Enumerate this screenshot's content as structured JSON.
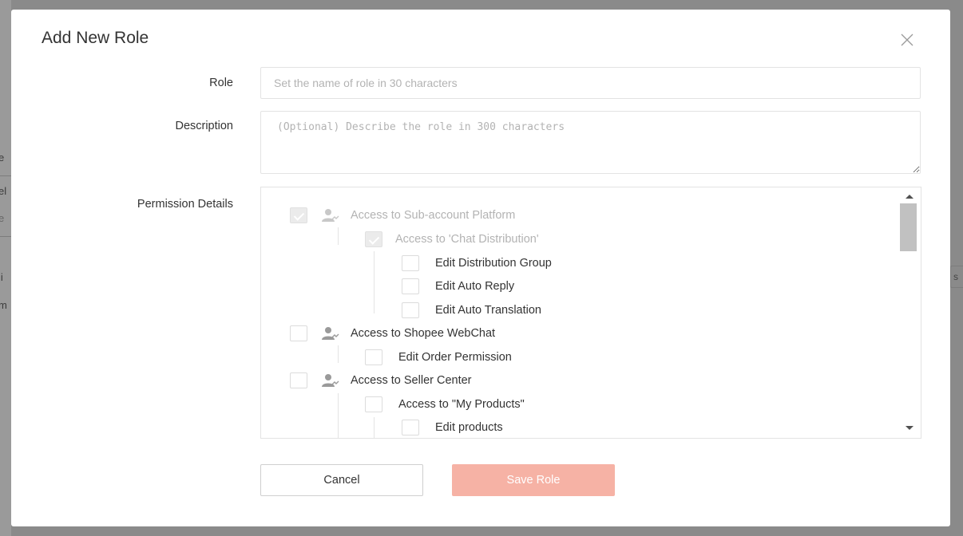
{
  "modal": {
    "title": "Add New Role"
  },
  "form": {
    "role_label": "Role",
    "role_placeholder": "Set the name of role in 30 characters",
    "role_value": "",
    "description_label": "Description",
    "description_placeholder": "(Optional) Describe the role in 300 characters",
    "description_value": "",
    "permission_label": "Permission Details"
  },
  "permissions": {
    "sub_account_platform": "Access to Sub-account Platform",
    "chat_distribution": "Access to 'Chat Distribution'",
    "edit_distribution_group": "Edit Distribution Group",
    "edit_auto_reply": "Edit Auto Reply",
    "edit_auto_translation": "Edit Auto Translation",
    "shopee_webchat": "Access to Shopee WebChat",
    "edit_order_permission": "Edit Order Permission",
    "seller_center": "Access to Seller Center",
    "my_products": "Access to \"My Products\"",
    "edit_products": "Edit products"
  },
  "buttons": {
    "cancel": "Cancel",
    "save": "Save Role"
  },
  "background": {
    "frag_1": "e",
    "frag_2": "el",
    "frag_3": "e",
    "frag_4": "li",
    "frag_5": "m",
    "right_frag": "s"
  },
  "colors": {
    "save_button": "#f6b2a5",
    "overlay": "#8a8a8a"
  },
  "icons": {
    "close": "close-icon",
    "user": "user-icon"
  }
}
